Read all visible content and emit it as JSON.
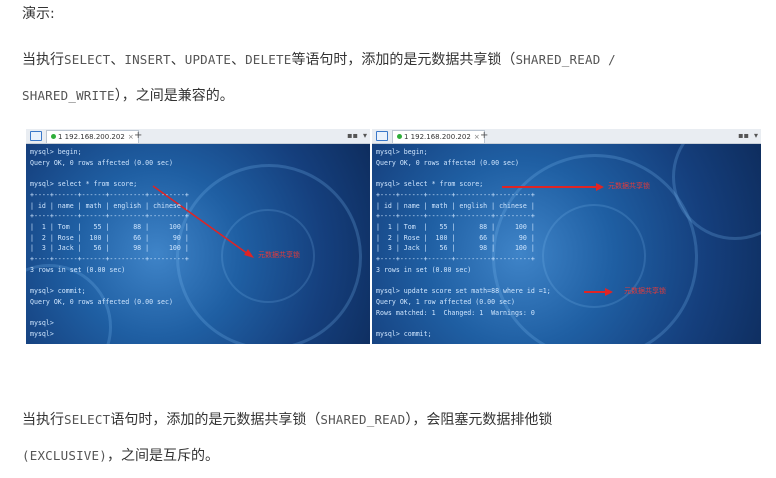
{
  "demo_label": "演示:",
  "para1": {
    "t1": "当执行",
    "c1": "SELECT",
    "s1": "、",
    "c2": "INSERT",
    "s2": "、",
    "c3": "UPDATE",
    "s3": "、",
    "c4": "DELETE",
    "t2": "等语句时，添加的是元数据共享锁（",
    "c5": "SHARED_READ /",
    "c6": "SHARED_WRITE",
    "t3": "），之间是兼容的。"
  },
  "para2": {
    "t1": "当执行",
    "c1": "SELECT",
    "t2": "语句时，添加的是元数据共享锁（",
    "c2": "SHARED_READ",
    "t3": "），会阻塞元数据排他锁",
    "c3": "(EXCLUSIVE)",
    "t4": "，之间是互斥的。"
  },
  "left_terminal": {
    "tab_label": "1 192.168.200.202",
    "lines": [
      "mysql> begin;",
      "Query OK, 0 rows affected (0.00 sec)",
      "",
      "mysql> select * from score;",
      "+----+------+------+---------+---------+",
      "| id | name | math | english | chinese |",
      "+----+------+------+---------+---------+",
      "|  1 | Tom  |   55 |      88 |     100 |",
      "|  2 | Rose |  100 |      66 |      90 |",
      "|  3 | Jack |   56 |      98 |     100 |",
      "+----+------+------+---------+---------+",
      "3 rows in set (0.00 sec)",
      "",
      "mysql> commit;",
      "Query OK, 0 rows affected (0.00 sec)",
      "",
      "mysql>",
      "mysql>"
    ],
    "annotation": "元数据共享锁"
  },
  "right_terminal": {
    "tab_label": "1 192.168.200.202",
    "lines": [
      "mysql> begin;",
      "Query OK, 0 rows affected (0.00 sec)",
      "",
      "mysql> select * from score;",
      "+----+------+------+---------+---------+",
      "| id | name | math | english | chinese |",
      "+----+------+------+---------+---------+",
      "|  1 | Tom  |   55 |      88 |     100 |",
      "|  2 | Rose |  100 |      66 |      90 |",
      "|  3 | Jack |   56 |      98 |     100 |",
      "+----+------+------+---------+---------+",
      "3 rows in set (0.00 sec)",
      "",
      "mysql> update score set math=88 where id =1;",
      "Query OK, 1 row affected (0.00 sec)",
      "Rows matched: 1  Changed: 1  Warnings: 0",
      "",
      "mysql> commit;"
    ],
    "annotation_top": "元数据共享锁",
    "annotation_bottom": "元数据共享锁"
  }
}
